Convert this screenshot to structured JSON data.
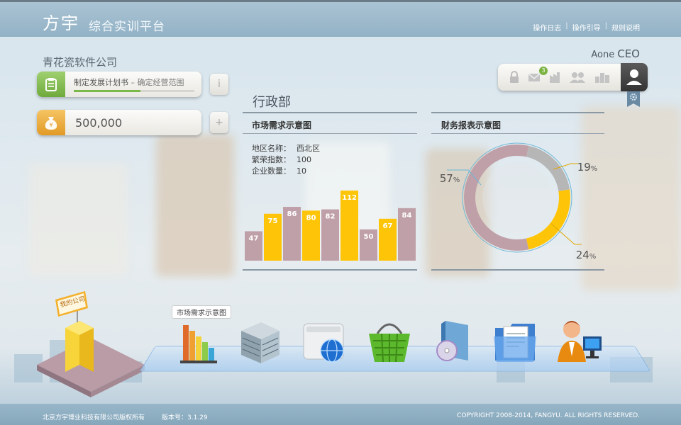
{
  "header": {
    "brand": "方宇",
    "subtitle": "综合实训平台",
    "links": [
      "操作日志",
      "操作引导",
      "规则说明"
    ]
  },
  "company": "青花瓷软件公司",
  "task": {
    "label": "制定发展计划书",
    "sep": " – ",
    "sub": "确定经营范围",
    "progress": 0.55
  },
  "money": "500,000",
  "buttons": {
    "info": "i",
    "add": "+"
  },
  "user": {
    "name": "Aone",
    "role": "CEO",
    "mail_badge": "3"
  },
  "department": "行政部",
  "market": {
    "title": "市场需求示意图",
    "region_label": "地区名称：",
    "region": "西北区",
    "prosperity_label": "繁荣指数：",
    "prosperity": "100",
    "companies_label": "企业数量：",
    "companies": "10"
  },
  "finance": {
    "title": "财务报表示意图"
  },
  "dock": {
    "tooltip": "市场需求示意图"
  },
  "building_sign": "我的公司",
  "footer": {
    "left": "北京方宇博业科技有限公司版权所有",
    "version": "版本号：3.1.29",
    "right": "COPYRIGHT 2008-2014, FANGYU. ALL RIGHTS RESERVED."
  },
  "colors": {
    "yellow": "#fec508",
    "mauve": "#bfa0a8",
    "accent": "#93b2c6"
  },
  "chart_data": [
    {
      "type": "bar",
      "title": "市场需求示意图",
      "values": [
        47,
        75,
        86,
        80,
        82,
        112,
        50,
        67,
        84
      ],
      "colors": [
        "mauve",
        "yellow",
        "mauve",
        "yellow",
        "mauve",
        "yellow",
        "mauve",
        "yellow",
        "mauve"
      ],
      "ylim": [
        0,
        120
      ],
      "grid": false
    },
    {
      "type": "pie",
      "title": "财务报表示意图",
      "slices": [
        {
          "label": "57%",
          "value": 57,
          "color": "#bfa0a8"
        },
        {
          "label": "19%",
          "value": 19,
          "color": "#b6b6b6"
        },
        {
          "label": "24%",
          "value": 24,
          "color": "#fec508"
        }
      ]
    }
  ]
}
